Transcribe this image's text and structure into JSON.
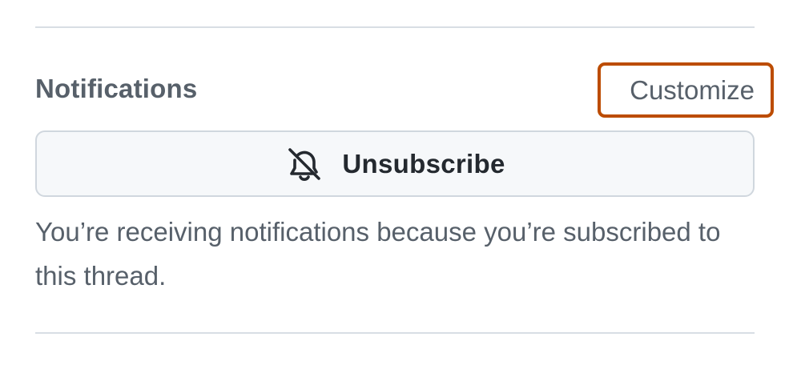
{
  "notifications": {
    "title": "Notifications",
    "customize_label": "Customize",
    "unsubscribe_label": "Unsubscribe",
    "unsubscribe_icon": "bell-slash-icon",
    "reason_text": "You’re receiving notifications because you’re subscribed to this thread."
  },
  "colors": {
    "highlight_border": "#bc4c00",
    "muted_text": "#57606a",
    "primary_text": "#24292f",
    "button_bg": "#f6f8fa",
    "border": "#d0d7de"
  }
}
